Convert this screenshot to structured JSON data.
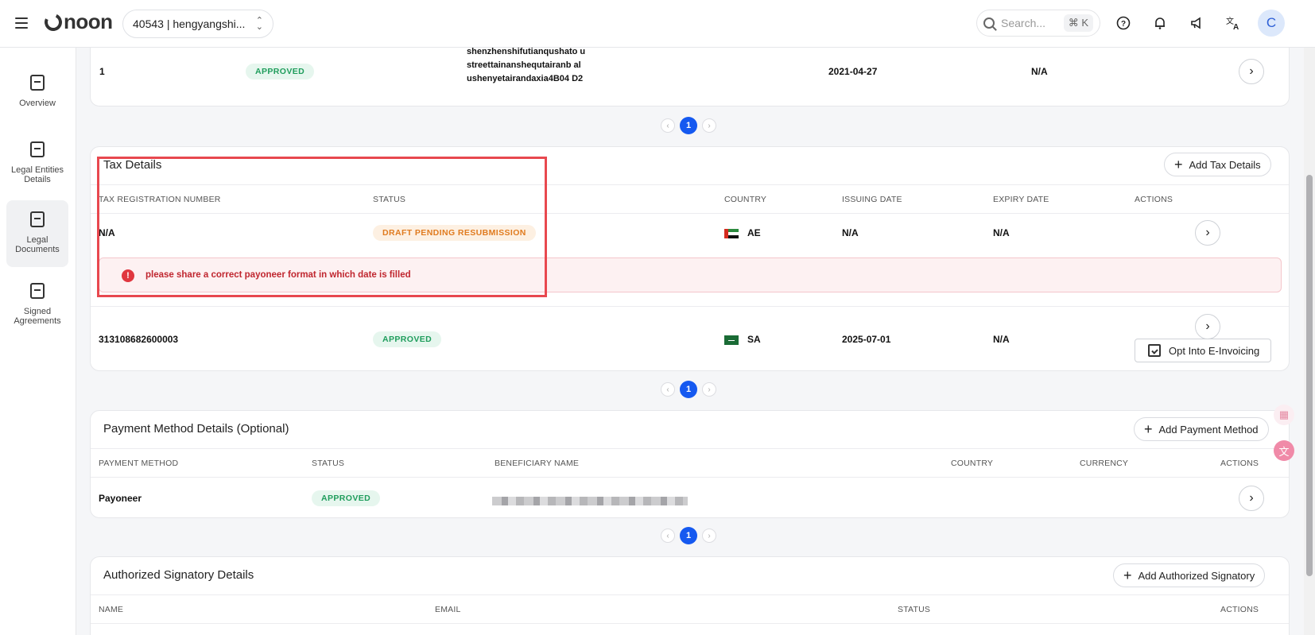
{
  "topbar": {
    "logo": "noon",
    "store_selector": "40543 | hengyangshi...",
    "search_placeholder": "Search...",
    "search_shortcut": "⌘ K",
    "avatar_initial": "C"
  },
  "sidebar": {
    "items": [
      {
        "label": "Overview"
      },
      {
        "label": "Legal Entities Details"
      },
      {
        "label": "Legal Documents"
      },
      {
        "label": "Signed Agreements"
      }
    ]
  },
  "legal_docs_row": {
    "number": "1",
    "status": "APPROVED",
    "address": "shenzhenshifutianqushato ustreettainanshequtairanb alushenyetairandaxia4B04 D2",
    "issue_date": "2021-04-27",
    "expiry": "N/A"
  },
  "pager": {
    "page": "1"
  },
  "tax_details": {
    "title": "Tax Details",
    "add_button": "Add Tax Details",
    "headers": [
      "TAX REGISTRATION NUMBER",
      "STATUS",
      "COUNTRY",
      "ISSUING DATE",
      "EXPIRY DATE",
      "ACTIONS"
    ],
    "rows": [
      {
        "number": "N/A",
        "status": "DRAFT PENDING RESUBMISSION",
        "country": "AE",
        "issuing": "N/A",
        "expiry": "N/A"
      },
      {
        "number": "313108682600003",
        "status": "APPROVED",
        "country": "SA",
        "issuing": "2025-07-01",
        "expiry": "N/A"
      }
    ],
    "error_message": "please share a correct payoneer format in which date is filled",
    "einvoice_button": "Opt Into E-Invoicing"
  },
  "payment_details": {
    "title": "Payment Method Details (Optional)",
    "add_button": "Add Payment Method",
    "headers": [
      "PAYMENT METHOD",
      "STATUS",
      "BENEFICIARY NAME",
      "COUNTRY",
      "CURRENCY",
      "ACTIONS"
    ],
    "rows": [
      {
        "method": "Payoneer",
        "status": "APPROVED"
      }
    ]
  },
  "signatory_details": {
    "title": "Authorized Signatory Details",
    "add_button": "Add Authorized Signatory",
    "headers": [
      "NAME",
      "EMAIL",
      "STATUS",
      "ACTIONS"
    ]
  },
  "colors": {
    "accent": "#1559f0",
    "approved": "#1f9d5c",
    "draft": "#e07b1f",
    "error": "#c0262f",
    "highlight": "#e8484f"
  }
}
